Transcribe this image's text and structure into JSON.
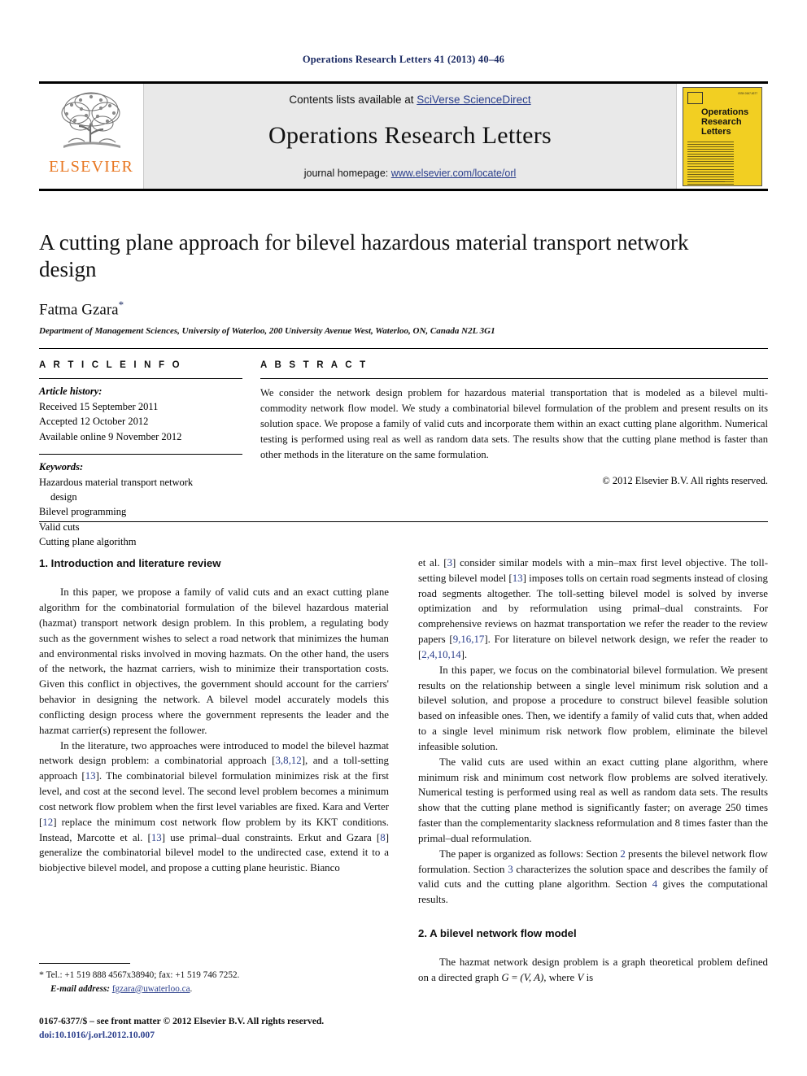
{
  "running_head": "Operations Research Letters 41 (2013) 40–46",
  "banner": {
    "publisher_logo_text": "ELSEVIER",
    "contents_prefix": "Contents lists available at ",
    "contents_link": "SciVerse ScienceDirect",
    "journal_name": "Operations Research Letters",
    "homepage_prefix": "journal homepage: ",
    "homepage_link": "www.elsevier.com/locate/orl",
    "cover": {
      "title": "Operations Research Letters",
      "issue_text": "Volume 41 Issue 1 January 2013",
      "issn_text": "ISSN 0167-6377"
    },
    "link_color": "#2b3f8c",
    "cover_color": "#f2cf22",
    "logo_color": "#e87722"
  },
  "article": {
    "title": "A cutting plane approach for bilevel hazardous material transport network design",
    "author": "Fatma Gzara",
    "author_marker": "*",
    "affiliation": "Department of Management Sciences, University of Waterloo, 200 University Avenue West, Waterloo, ON, Canada N2L 3G1"
  },
  "article_info": {
    "label": "A R T I C L E  I N F O",
    "history_label": "Article history:",
    "history": [
      "Received 15 September 2011",
      "Accepted 12 October 2012",
      "Available online 9 November 2012"
    ],
    "keywords_label": "Keywords:",
    "keywords": [
      "Hazardous material transport network",
      "design",
      "Bilevel programming",
      "Valid cuts",
      "Cutting plane algorithm"
    ]
  },
  "abstract": {
    "label": "A B S T R A C T",
    "text": "We consider the network design problem for hazardous material transportation that is modeled as a bilevel multi-commodity network flow model. We study a combinatorial bilevel formulation of the problem and present results on its solution space. We propose a family of valid cuts and incorporate them within an exact cutting plane algorithm. Numerical testing is performed using real as well as random data sets. The results show that the cutting plane method is faster than other methods in the literature on the same formulation.",
    "copyright": "© 2012 Elsevier B.V. All rights reserved."
  },
  "body": {
    "section1_heading": "1. Introduction and literature review",
    "left_p1": "In this paper, we propose a family of valid cuts and an exact cutting plane algorithm for the combinatorial formulation of the bilevel hazardous material (hazmat) transport network design problem. In this problem, a regulating body such as the government wishes to select a road network that minimizes the human and environmental risks involved in moving hazmats. On the other hand, the users of the network, the hazmat carriers, wish to minimize their transportation costs. Given this conflict in objectives, the government should account for the carriers' behavior in designing the network. A bilevel model accurately models this conflicting design process where the government represents the leader and the hazmat carrier(s) represent the follower.",
    "left_p2_a": "In the literature, two approaches were introduced to model the bilevel hazmat network design problem: a combinatorial approach [",
    "left_p2_ref1": "3,8,12",
    "left_p2_b": "], and a toll-setting approach [",
    "left_p2_ref2": "13",
    "left_p2_c": "]. The combinatorial bilevel formulation minimizes risk at the first level, and cost at the second level. The second level problem becomes a minimum cost network flow problem when the first level variables are fixed. Kara and Verter [",
    "left_p2_ref3": "12",
    "left_p2_d": "] replace the minimum cost network flow problem by its KKT conditions. Instead, Marcotte et al. [",
    "left_p2_ref4": "13",
    "left_p2_e": "] use primal–dual constraints. Erkut and Gzara [",
    "left_p2_ref5": "8",
    "left_p2_f": "] generalize the combinatorial bilevel model to the undirected case, extend it to a biobjective bilevel model, and propose a cutting plane heuristic. Bianco",
    "right_p1_a": "et al. [",
    "right_p1_ref1": "3",
    "right_p1_b": "] consider similar models with a min–max first level objective. The toll-setting bilevel model [",
    "right_p1_ref2": "13",
    "right_p1_c": "] imposes tolls on certain road segments instead of closing road segments altogether. The toll-setting bilevel model is solved by inverse optimization and by reformulation using primal–dual constraints. For comprehensive reviews on hazmat transportation we refer the reader to the review papers [",
    "right_p1_ref3": "9,16,17",
    "right_p1_d": "]. For literature on bilevel network design, we refer the reader to [",
    "right_p1_ref4": "2,4,10,14",
    "right_p1_e": "].",
    "right_p2": "In this paper, we focus on the combinatorial bilevel formulation. We present results on the relationship between a single level minimum risk solution and a bilevel solution, and propose a procedure to construct bilevel feasible solution based on infeasible ones. Then, we identify a family of valid cuts that, when added to a single level minimum risk network flow problem, eliminate the bilevel infeasible solution.",
    "right_p3": "The valid cuts are used within an exact cutting plane algorithm, where minimum risk and minimum cost network flow problems are solved iteratively. Numerical testing is performed using real as well as random data sets. The results show that the cutting plane method is significantly faster; on average 250 times faster than the complementarity slackness reformulation and 8 times faster than the primal–dual reformulation.",
    "right_p4_a": "The paper is organized as follows: Section ",
    "right_p4_ref1": "2",
    "right_p4_b": " presents the bilevel network flow formulation. Section ",
    "right_p4_ref2": "3",
    "right_p4_c": " characterizes the solution space and describes the family of valid cuts and the cutting plane algorithm. Section ",
    "right_p4_ref3": "4",
    "right_p4_d": " gives the computational results.",
    "section2_heading": "2. A bilevel network flow model",
    "right_p5_a": "The hazmat network design problem is a graph theoretical problem defined on a directed graph ",
    "right_p5_math1": "G",
    "right_p5_b": " = ",
    "right_p5_math2": "(V, A)",
    "right_p5_c": ", where ",
    "right_p5_math3": "V",
    "right_p5_d": " is"
  },
  "footnote": {
    "marker": "*",
    "tel": "Tel.: +1 519 888 4567x38940; fax: +1 519 746 7252.",
    "email_label": "E-mail address:",
    "email": "fgzara@uwaterloo.ca",
    "email_period": ".",
    "imprint": "0167-6377/$ – see front matter © 2012 Elsevier B.V. All rights reserved.",
    "doi": "doi:10.1016/j.orl.2012.10.007"
  }
}
